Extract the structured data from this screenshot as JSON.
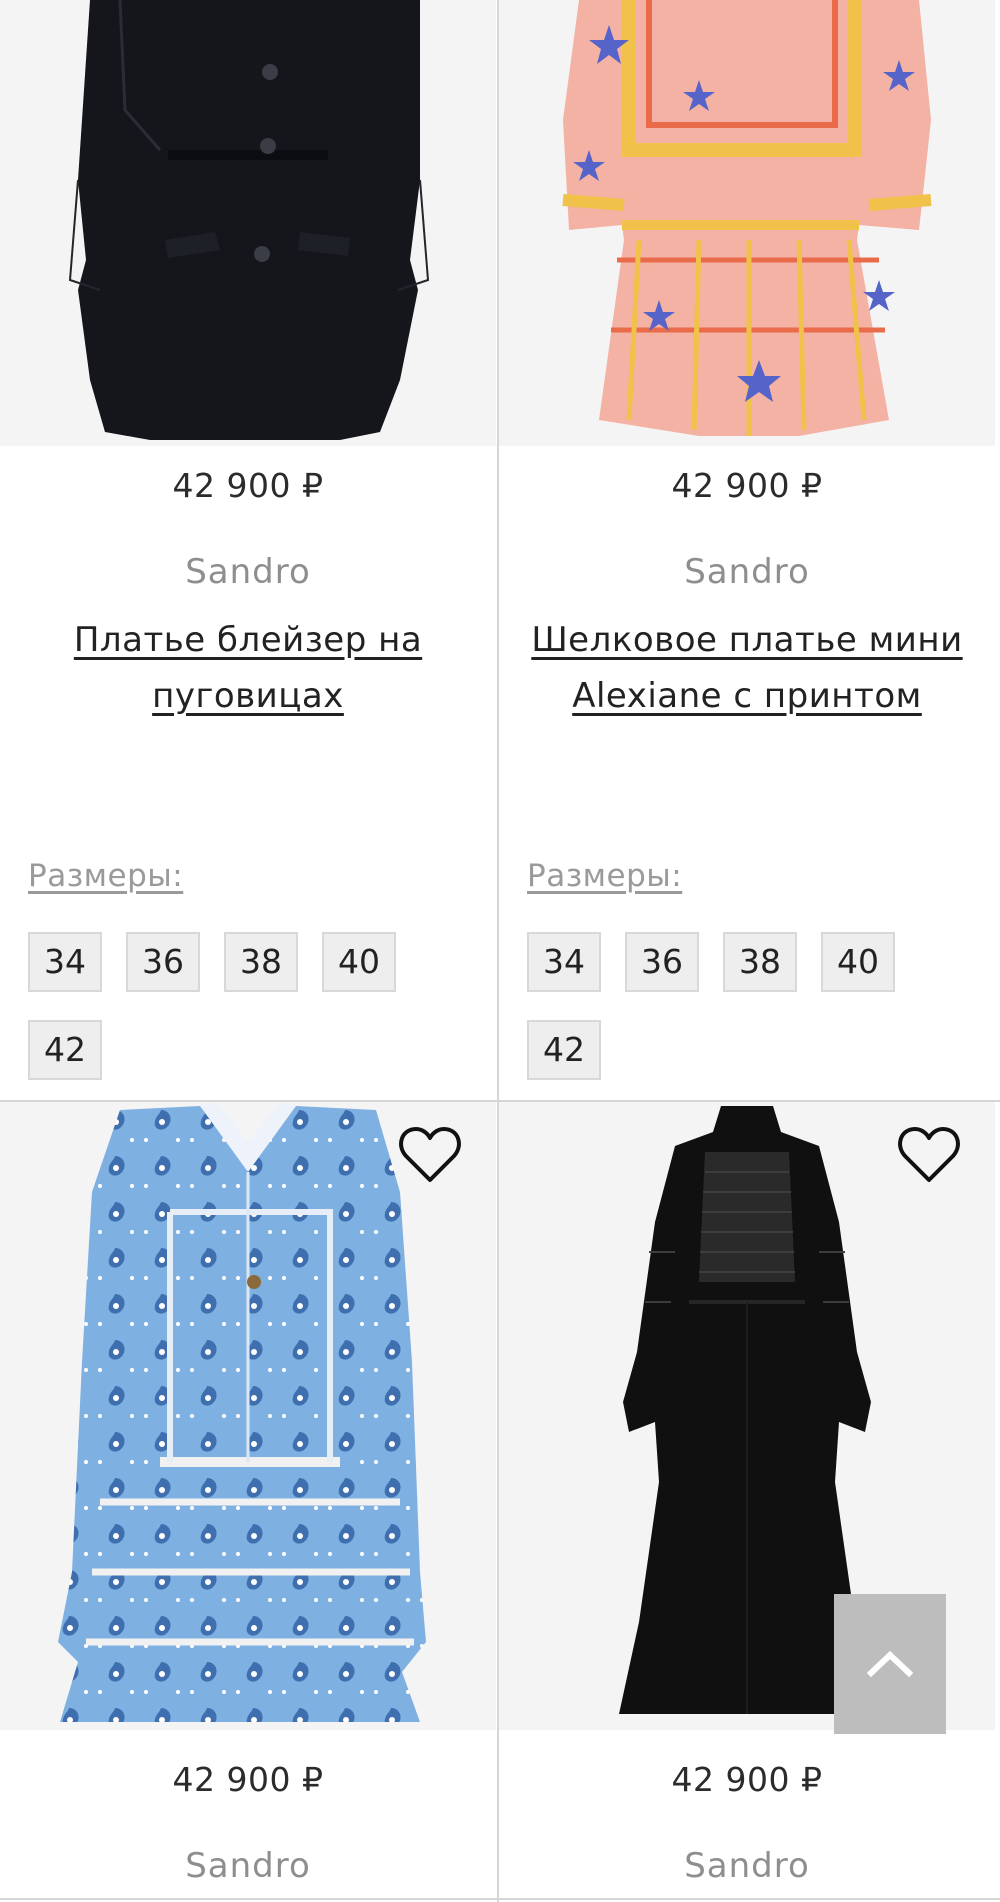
{
  "products": [
    {
      "price": "42 900 ₽",
      "brand": "Sandro",
      "title": "Платье блейзер на пуговицах",
      "sizes_label": "Размеры:",
      "sizes": [
        "34",
        "36",
        "38",
        "40",
        "42"
      ],
      "image": "black-blazer-dress"
    },
    {
      "price": "42 900 ₽",
      "brand": "Sandro",
      "title": "Шелковое платье мини Alexiane с принтом",
      "sizes_label": "Размеры:",
      "sizes": [
        "34",
        "36",
        "38",
        "40",
        "42"
      ],
      "image": "pink-silk-print-dress"
    },
    {
      "price": "42 900 ₽",
      "brand": "Sandro",
      "favorite_icon": "heart-outline-icon",
      "image": "blue-paisley-shirt-dress"
    },
    {
      "price": "42 900 ₽",
      "brand": "Sandro",
      "favorite_icon": "heart-outline-icon",
      "image": "black-lace-maxi-dress"
    }
  ],
  "scroll_top_icon": "chevron-up-icon",
  "colors": {
    "image_bg": "#f4f4f4",
    "divider": "#d6d6d6",
    "chip_bg": "#eeeeee",
    "brand_text": "#8e8e8e",
    "scroll_top_bg": "#bdbdbd"
  }
}
